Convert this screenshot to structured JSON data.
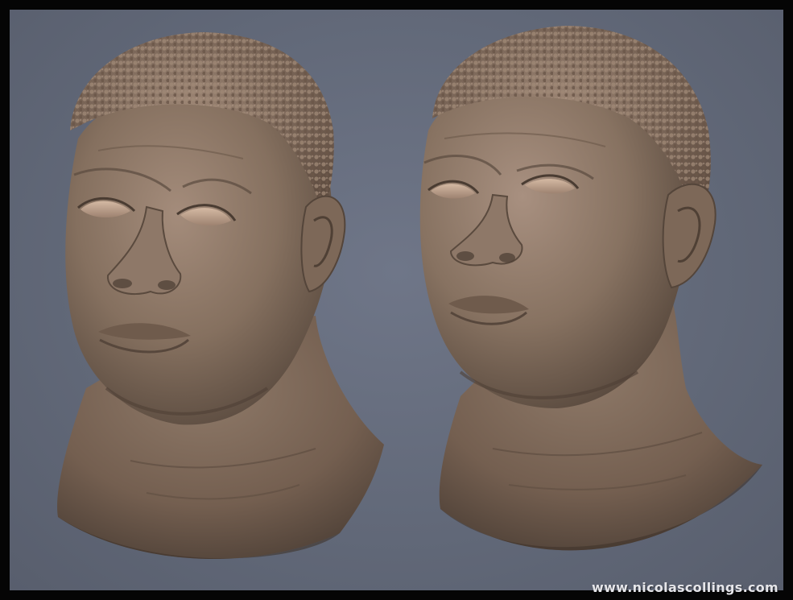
{
  "render": {
    "subject": "sculpted-head-render",
    "views": [
      "three-quarter-left",
      "three-quarter-right"
    ],
    "background_color": "#626979",
    "frame_color": "#050505",
    "clay_color": "#8b7565"
  },
  "watermark": {
    "text": "www.nicolascollings.com"
  }
}
